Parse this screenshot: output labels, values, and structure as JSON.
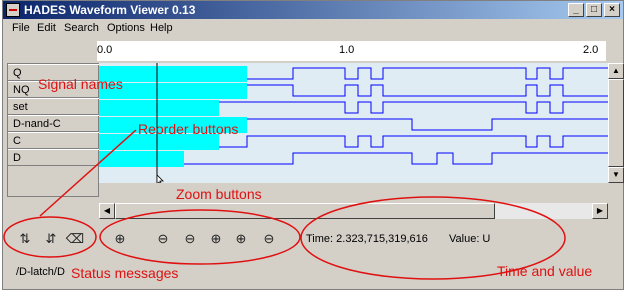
{
  "window": {
    "title": "HADES Waveform Viewer 0.13",
    "controls": {
      "minimize": "_",
      "maximize": "□",
      "close": "×"
    }
  },
  "menu": [
    "File",
    "Edit",
    "Search",
    "Options",
    "Help"
  ],
  "ruler": {
    "ticks": [
      "0.0",
      "1.0",
      "2.0"
    ]
  },
  "signals": [
    "Q",
    "NQ",
    "set",
    "D-nand-C",
    "C",
    "D"
  ],
  "toolbar": {
    "reorder_icons": [
      "move-up-icon",
      "move-down-icon",
      "delete-icon"
    ],
    "zoom_icons": [
      "zoom-fit-icon",
      "zoom-out-icon",
      "zoom-out-2-icon",
      "zoom-in-icon",
      "zoom-in-2-icon",
      "zoom-out-3-icon"
    ]
  },
  "readout": {
    "time": "Time: 2.323,715,319,616",
    "value": "Value: U"
  },
  "status": "/D-latch/D",
  "annotations": {
    "signal_names": "Signal names",
    "reorder_buttons": "Reorder buttons",
    "zoom_buttons": "Zoom buttons",
    "status_messages": "Status messages",
    "time_and_value": "Time and value"
  },
  "colors": {
    "undefined_fill": "#00ffff",
    "wave_line": "#0000ff",
    "annotation": "#e01010",
    "wave_bg": "#e0ecf4"
  }
}
